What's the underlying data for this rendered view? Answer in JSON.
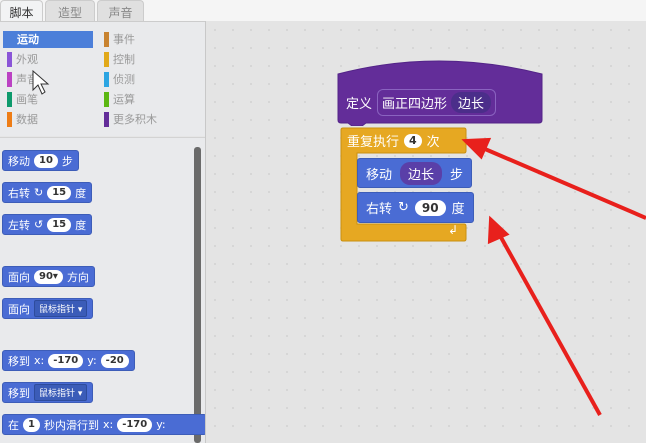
{
  "tabs": [
    "脚本",
    "造型",
    "声音"
  ],
  "categories": {
    "left": [
      {
        "label": "运动",
        "color": "#4c7fd9"
      },
      {
        "label": "外观",
        "color": "#8a55d7"
      },
      {
        "label": "声音",
        "color": "#bb42c3"
      },
      {
        "label": "画笔",
        "color": "#0e9a6c"
      },
      {
        "label": "数据",
        "color": "#ee7d16"
      }
    ],
    "right": [
      {
        "label": "事件",
        "color": "#c88330"
      },
      {
        "label": "控制",
        "color": "#e1a91a"
      },
      {
        "label": "侦测",
        "color": "#2ca5e2"
      },
      {
        "label": "运算",
        "color": "#5cb712"
      },
      {
        "label": "更多积木",
        "color": "#632d99"
      }
    ]
  },
  "palette": {
    "move": {
      "label": "移动",
      "value": "10",
      "unit": "步"
    },
    "turn_right": {
      "label": "右转",
      "value": "15",
      "unit": "度"
    },
    "turn_left": {
      "label": "左转",
      "value": "15",
      "unit": "度"
    },
    "point_dir": {
      "label": "面向",
      "value": "90▾",
      "unit": "方向"
    },
    "point_towards": {
      "label": "面向",
      "value": "鼠标指针 ▾"
    },
    "goto_xy": {
      "label": "移到",
      "x_label": "x:",
      "x": "-170",
      "y_label": "y:",
      "y": "-20"
    },
    "goto": {
      "label": "移到",
      "value": "鼠标指针 ▾"
    },
    "glide": {
      "label": "在",
      "secs": "1",
      "mid": "秒内滑行到",
      "x_label": "x:",
      "x": "-170",
      "y_label": "y:"
    }
  },
  "script": {
    "define_label": "定义",
    "proc_name": "画正四边形",
    "param": "边长",
    "repeat_label": "重复执行",
    "repeat_count": "4",
    "repeat_unit": "次",
    "move_label": "移动",
    "move_arg": "边长",
    "move_unit": "步",
    "turn_label": "右转",
    "turn_arg": "90",
    "turn_unit": "度"
  },
  "colors": {
    "motion": "#4a6cd4",
    "control": "#e6a822",
    "custom": "#632d99",
    "arrow": "#e8201c"
  }
}
